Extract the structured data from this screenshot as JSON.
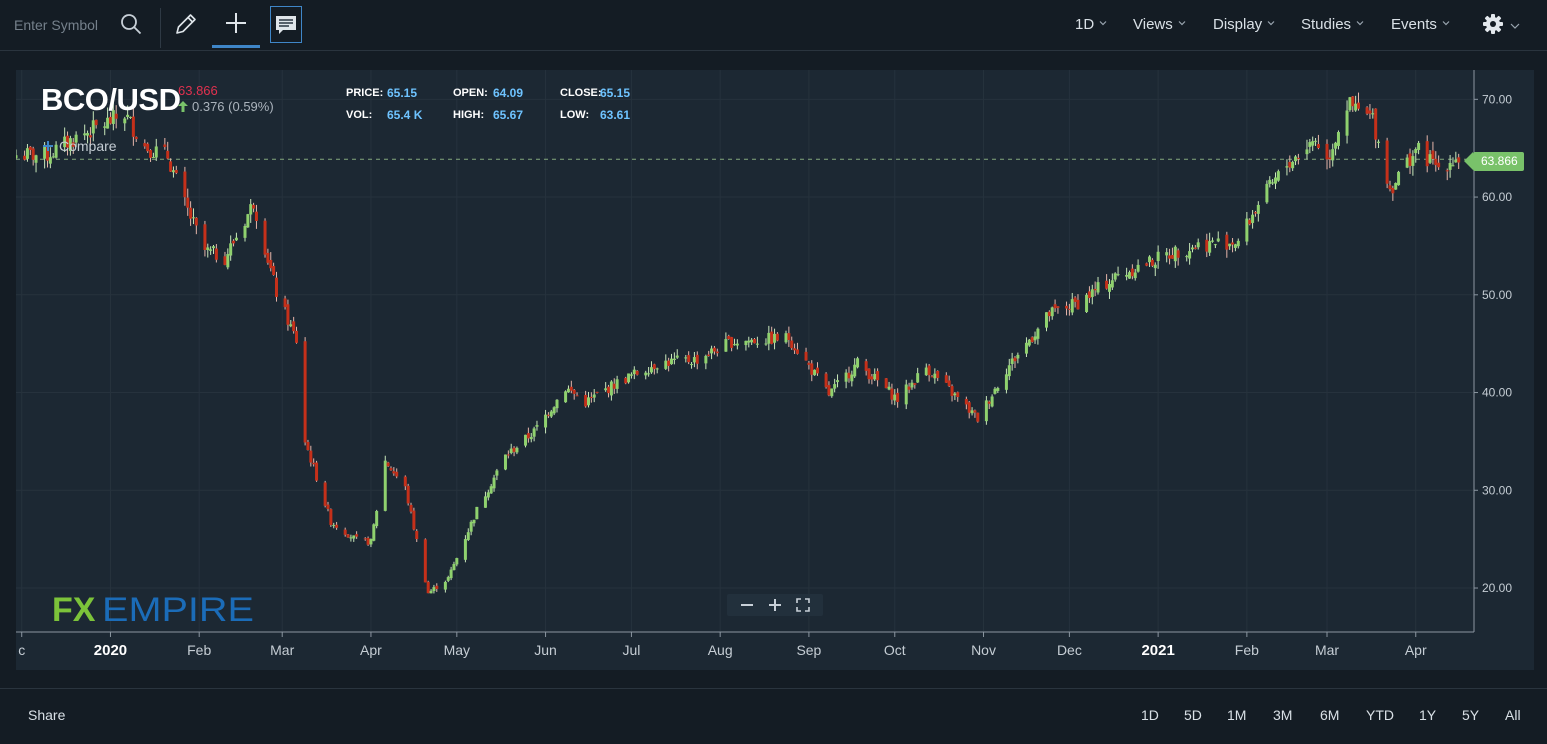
{
  "toolbar": {
    "symbol_placeholder": "Enter Symbol",
    "icons": [
      "search-icon",
      "pencil-icon",
      "crosshair-plus-icon",
      "news-icon",
      "gear-icon",
      "chevron-down-icon"
    ],
    "menus": [
      {
        "label": "1D"
      },
      {
        "label": "Views"
      },
      {
        "label": "Display"
      },
      {
        "label": "Studies"
      },
      {
        "label": "Events"
      }
    ]
  },
  "header": {
    "ticker": "BCO/USD",
    "last_price": "63.866",
    "change": "0.376 (0.59%)",
    "stats": {
      "price_label": "PRICE:",
      "price": "65.15",
      "open_label": "OPEN:",
      "open": "64.09",
      "close_label": "CLOSE:",
      "close": "65.15",
      "vol_label": "VOL:",
      "vol": "65.4 K",
      "high_label": "HIGH:",
      "high": "65.67",
      "low_label": "LOW:",
      "low": "63.61"
    },
    "compare_label": "Compare",
    "price_tag": "63.866"
  },
  "colors": {
    "up": "#8fd16e",
    "down": "#c5301a",
    "accent": "#3f86c8",
    "last_price": "#e0314f",
    "price_tag": "#79c26a"
  },
  "chart_data": {
    "type": "candlestick",
    "title": "BCO/USD",
    "ylim": [
      15.5,
      73.0
    ],
    "y_ticks": [
      "70.00",
      "60.00",
      "50.00",
      "40.00",
      "30.00",
      "20.00"
    ],
    "y_tick_values": [
      70,
      60,
      50,
      40,
      30,
      20
    ],
    "x_ticks": [
      {
        "label": "c",
        "date": "2019-12-01"
      },
      {
        "label": "2020",
        "date": "2020-01-01"
      },
      {
        "label": "Feb",
        "date": "2020-02-01"
      },
      {
        "label": "Mar",
        "date": "2020-03-01"
      },
      {
        "label": "Apr",
        "date": "2020-04-01"
      },
      {
        "label": "May",
        "date": "2020-05-01"
      },
      {
        "label": "Jun",
        "date": "2020-06-01"
      },
      {
        "label": "Jul",
        "date": "2020-07-01"
      },
      {
        "label": "Aug",
        "date": "2020-08-01"
      },
      {
        "label": "Sep",
        "date": "2020-09-01"
      },
      {
        "label": "Oct",
        "date": "2020-10-01"
      },
      {
        "label": "Nov",
        "date": "2020-11-01"
      },
      {
        "label": "Dec",
        "date": "2020-12-01"
      },
      {
        "label": "2021",
        "date": "2021-01-01"
      },
      {
        "label": "Feb",
        "date": "2021-02-01"
      },
      {
        "label": "Mar",
        "date": "2021-03-01"
      },
      {
        "label": "Apr",
        "date": "2021-04-01"
      }
    ],
    "close_series": [
      {
        "date": "2019-12-10",
        "close": 64.3
      },
      {
        "date": "2019-12-20",
        "close": 66.1
      },
      {
        "date": "2020-01-06",
        "close": 68.5
      },
      {
        "date": "2020-01-13",
        "close": 65.2
      },
      {
        "date": "2020-01-21",
        "close": 64.2
      },
      {
        "date": "2020-01-27",
        "close": 59.3
      },
      {
        "date": "2020-02-03",
        "close": 54.5
      },
      {
        "date": "2020-02-10",
        "close": 53.8
      },
      {
        "date": "2020-02-17",
        "close": 57.6
      },
      {
        "date": "2020-02-20",
        "close": 59.5
      },
      {
        "date": "2020-02-28",
        "close": 50.2
      },
      {
        "date": "2020-03-06",
        "close": 45.3
      },
      {
        "date": "2020-03-09",
        "close": 35.0
      },
      {
        "date": "2020-03-18",
        "close": 26.8
      },
      {
        "date": "2020-03-27",
        "close": 24.9
      },
      {
        "date": "2020-04-01",
        "close": 24.7
      },
      {
        "date": "2020-04-06",
        "close": 33.0
      },
      {
        "date": "2020-04-13",
        "close": 30.2
      },
      {
        "date": "2020-04-21",
        "close": 19.5
      },
      {
        "date": "2020-04-28",
        "close": 21.0
      },
      {
        "date": "2020-05-08",
        "close": 28.0
      },
      {
        "date": "2020-05-18",
        "close": 33.5
      },
      {
        "date": "2020-05-28",
        "close": 36.0
      },
      {
        "date": "2020-06-08",
        "close": 40.5
      },
      {
        "date": "2020-06-15",
        "close": 39.0
      },
      {
        "date": "2020-06-26",
        "close": 41.0
      },
      {
        "date": "2020-07-10",
        "close": 43.0
      },
      {
        "date": "2020-07-24",
        "close": 43.4
      },
      {
        "date": "2020-08-05",
        "close": 45.2
      },
      {
        "date": "2020-08-25",
        "close": 45.6
      },
      {
        "date": "2020-09-08",
        "close": 39.8
      },
      {
        "date": "2020-09-18",
        "close": 43.0
      },
      {
        "date": "2020-10-02",
        "close": 39.3
      },
      {
        "date": "2020-10-12",
        "close": 42.6
      },
      {
        "date": "2020-10-30",
        "close": 37.3
      },
      {
        "date": "2020-11-09",
        "close": 42.4
      },
      {
        "date": "2020-11-24",
        "close": 48.0
      },
      {
        "date": "2020-12-04",
        "close": 49.2
      },
      {
        "date": "2020-12-18",
        "close": 52.0
      },
      {
        "date": "2021-01-06",
        "close": 54.3
      },
      {
        "date": "2021-01-15",
        "close": 55.1
      },
      {
        "date": "2021-01-29",
        "close": 55.5
      },
      {
        "date": "2021-02-05",
        "close": 59.3
      },
      {
        "date": "2021-02-15",
        "close": 63.3
      },
      {
        "date": "2021-02-25",
        "close": 66.0
      },
      {
        "date": "2021-03-01",
        "close": 63.7
      },
      {
        "date": "2021-03-08",
        "close": 69.4
      },
      {
        "date": "2021-03-17",
        "close": 68.0
      },
      {
        "date": "2021-03-23",
        "close": 60.8
      },
      {
        "date": "2021-04-01",
        "close": 64.9
      },
      {
        "date": "2021-04-09",
        "close": 63.0
      },
      {
        "date": "2021-04-14",
        "close": 63.9
      }
    ],
    "reference_line": 63.866,
    "grid": true
  },
  "zoom": {
    "icons": [
      "zoom-out-icon",
      "zoom-in-icon",
      "fullscreen-icon"
    ]
  },
  "logo": {
    "text": "FXEMPIRE",
    "fx": "FX",
    "empire": "EMPIRE"
  },
  "footer": {
    "share_label": "Share",
    "ranges": [
      "1D",
      "5D",
      "1M",
      "3M",
      "6M",
      "YTD",
      "1Y",
      "5Y",
      "All"
    ]
  }
}
